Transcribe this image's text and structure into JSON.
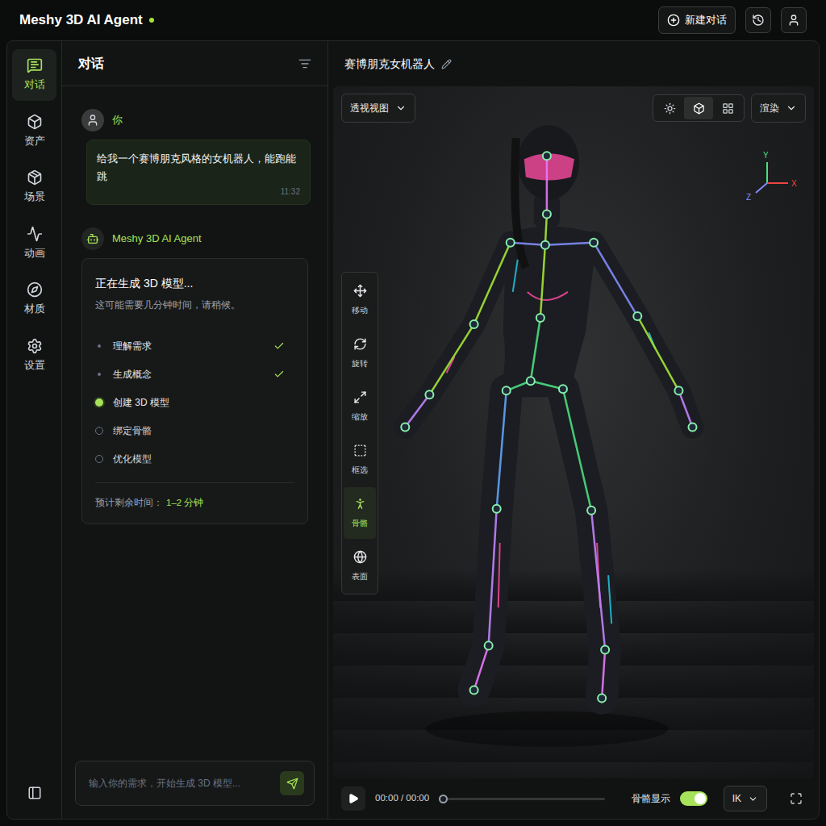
{
  "app": {
    "title": "Meshy 3D AI Agent",
    "online": true
  },
  "header": {
    "new_chat": "新建对话"
  },
  "nav": [
    {
      "label": "对话",
      "selected": true
    },
    {
      "label": "资产",
      "selected": false
    },
    {
      "label": "场景",
      "selected": false
    },
    {
      "label": "动画",
      "selected": false
    },
    {
      "label": "材质",
      "selected": false
    },
    {
      "label": "设置",
      "selected": false
    }
  ],
  "chat": {
    "title": "对话",
    "user_message": {
      "author": "你",
      "text": "给我一个赛博朋克风格的女机器人，能跑能跳",
      "time": "11:32"
    },
    "agent": {
      "author": "Meshy 3D AI Agent",
      "status_title": "正在生成 3D 模型...",
      "status_note": "这可能需要几分钟时间，请稍候。",
      "steps": [
        {
          "label": "理解需求",
          "status": "done"
        },
        {
          "label": "生成概念",
          "status": "done"
        },
        {
          "label": "创建 3D 模型",
          "status": "active"
        },
        {
          "label": "绑定骨骼",
          "status": "pending"
        },
        {
          "label": "优化模型",
          "status": "pending"
        }
      ],
      "eta_label": "预计剩余时间：",
      "eta_value": "1–2 分钟"
    },
    "input": {
      "placeholder": "输入你的需求，开始生成 3D 模型..."
    }
  },
  "viewport": {
    "title": "赛博朋克女机器人",
    "view_mode": "透视视图",
    "display_modes": [
      {
        "selected": false
      },
      {
        "selected": true
      },
      {
        "selected": false
      }
    ],
    "render": "渲染",
    "axes": {
      "y": "Y",
      "x": "X",
      "z": "Z"
    },
    "tools": [
      {
        "label": "移动",
        "selected": false
      },
      {
        "label": "旋转",
        "selected": false
      },
      {
        "label": "缩放",
        "selected": false
      },
      {
        "label": "框选",
        "selected": false
      },
      {
        "label": "骨骼",
        "selected": true
      },
      {
        "label": "表面",
        "selected": false
      }
    ],
    "timeline": {
      "playing": false,
      "time": "00:00 / 00:00",
      "level": 0,
      "skeleton_label": "骨骼显示",
      "skeleton_on": true,
      "ik": "IK"
    }
  }
}
